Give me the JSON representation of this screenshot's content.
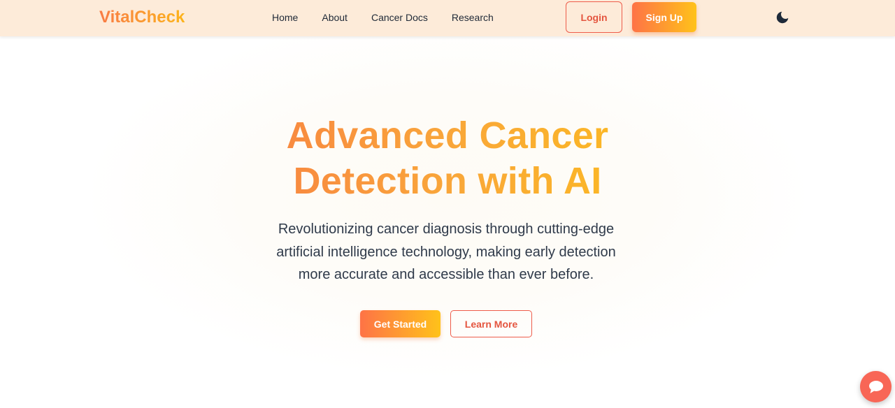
{
  "navbar": {
    "brand": "VitalCheck",
    "links": [
      "Home",
      "About",
      "Cancer Docs",
      "Research"
    ],
    "login_label": "Login",
    "signup_label": "Sign Up",
    "theme_icon": "moon-icon"
  },
  "hero": {
    "title_line1": "Advanced Cancer",
    "title_line2": "Detection with AI",
    "subtitle": "Revolutionizing cancer diagnosis through cutting-edge artificial intelligence technology, making early detection more accurate and accessible than ever before.",
    "primary_cta": "Get Started",
    "secondary_cta": "Learn More"
  },
  "chat": {
    "icon": "chat-bubble-icon"
  },
  "colors": {
    "navbar_bg": "#fdebd9",
    "accent_start": "#fe7346",
    "accent_end": "#ffc21a",
    "outline_red": "#ee5c4a",
    "chat_fab": "#f86656"
  }
}
